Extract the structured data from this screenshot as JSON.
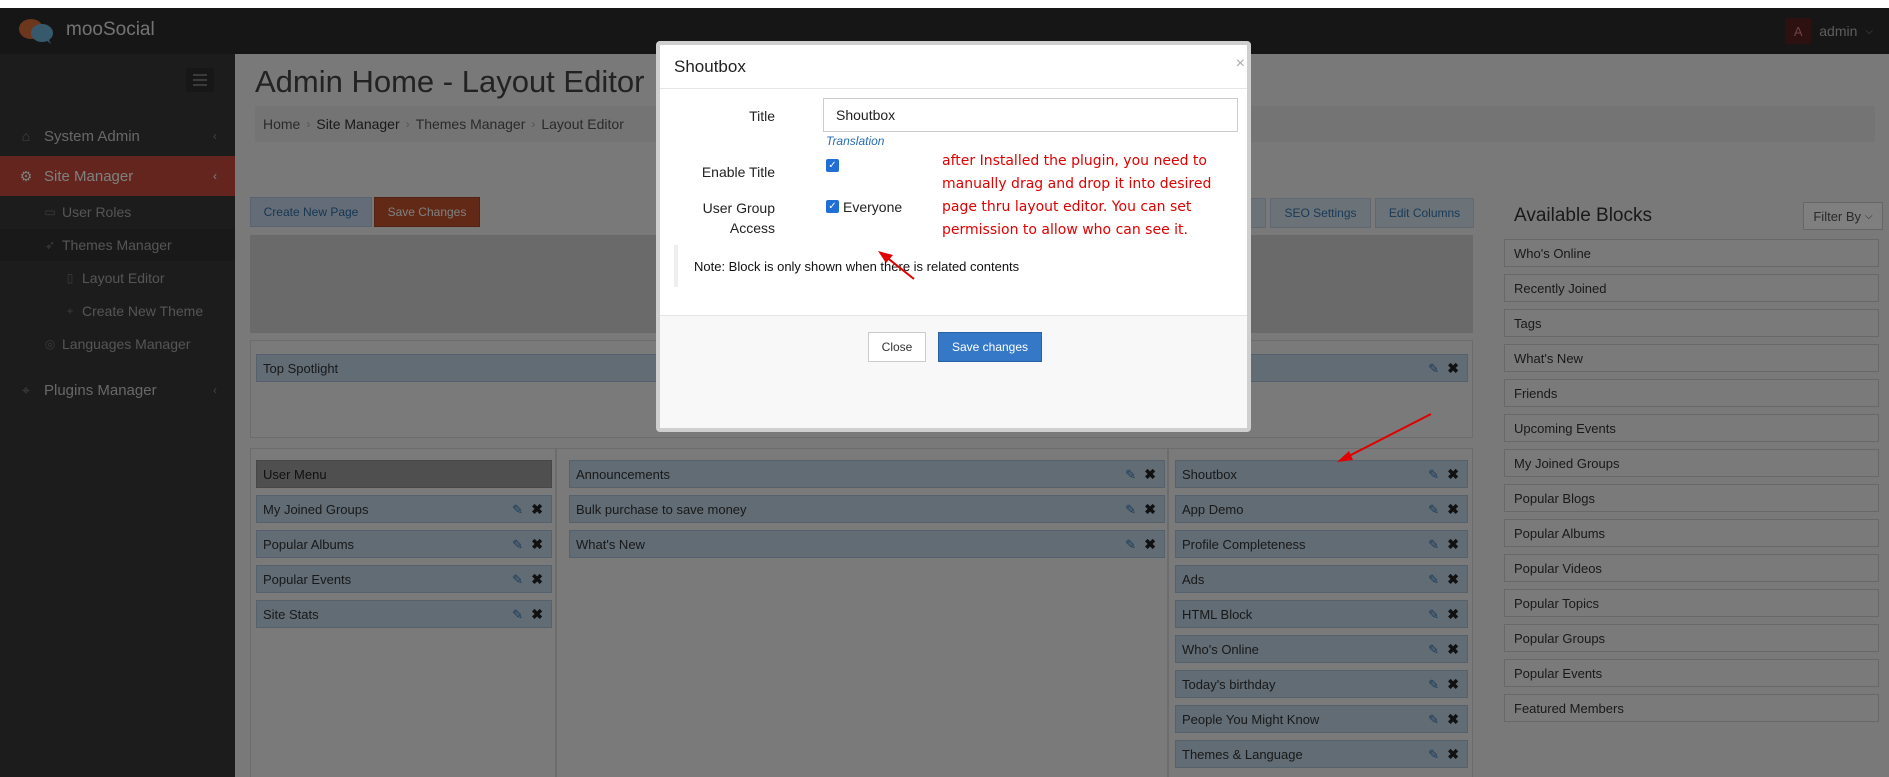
{
  "app": {
    "brand": "mooSocial",
    "user_initial": "A",
    "user_name": "admin"
  },
  "sidebar": {
    "items": [
      {
        "label": "System Admin",
        "icon": "home-icon"
      },
      {
        "label": "Site Manager",
        "icon": "gears-icon"
      },
      {
        "label": "Plugins Manager",
        "icon": "tags-icon"
      }
    ],
    "sub_items": [
      {
        "label": "User Roles",
        "icon": "briefcase-icon"
      },
      {
        "label": "Themes Manager",
        "icon": "rocket-icon"
      },
      {
        "label": "Layout Editor",
        "icon": "columns-icon"
      },
      {
        "label": "Create New Theme",
        "icon": "plus-icon"
      },
      {
        "label": "Languages Manager",
        "icon": "globe-icon"
      }
    ]
  },
  "page": {
    "title": "Admin Home - Layout Editor",
    "breadcrumb": [
      "Home",
      "Site Manager",
      "Themes Manager",
      "Layout Editor"
    ]
  },
  "toolbar": {
    "create_page": "Create New Page",
    "save_changes": "Save Changes",
    "seo_settings": "SEO Settings",
    "edit_columns": "Edit Columns"
  },
  "layout": {
    "top_spotlight": "Top Spotlight",
    "left_column": [
      "User Menu",
      "My Joined Groups",
      "Popular Albums",
      "Popular Events",
      "Site Stats"
    ],
    "center_column": [
      "Announcements",
      "Bulk purchase to save money",
      "What's New"
    ],
    "right_column": [
      "Shoutbox",
      "App Demo",
      "Profile Completeness",
      "Ads",
      "HTML Block",
      "Who's Online",
      "Today's birthday",
      "People You Might Know",
      "Themes & Language"
    ]
  },
  "available_blocks": {
    "title": "Available Blocks",
    "filter_label": "Filter By",
    "items": [
      "Who's Online",
      "Recently Joined",
      "Tags",
      "What's New",
      "Friends",
      "Upcoming Events",
      "My Joined Groups",
      "Popular Blogs",
      "Popular Albums",
      "Popular Videos",
      "Popular Topics",
      "Popular Groups",
      "Popular Events",
      "Featured Members"
    ]
  },
  "modal": {
    "title": "Shoutbox",
    "close_icon": "×",
    "title_label": "Title",
    "title_value": "Shoutbox",
    "translation_link": "Translation",
    "enable_title_label": "Enable Title",
    "enable_title_checked": true,
    "user_group_label": "User Group Access",
    "user_group_value": "Everyone",
    "annotation": "after Installed the plugin, you need to manually drag and drop it into desired page thru layout editor. You can set permission to allow who can see it.",
    "note": "Note: Block is only shown when there is related contents",
    "close_button": "Close",
    "save_button": "Save changes"
  },
  "colors": {
    "topbar": "#2c2c2c",
    "sidebar": "#383838",
    "active_nav": "#c64a3b",
    "block": "#c2d8ea",
    "primary": "#3478c7",
    "annotation": "#e00000"
  }
}
